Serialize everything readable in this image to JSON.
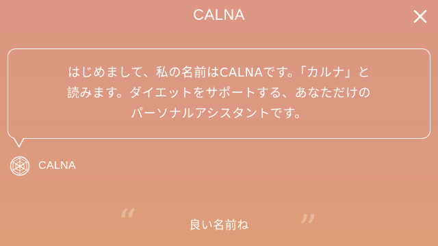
{
  "header": {
    "title": "CALNA",
    "close_icon": "close-icon"
  },
  "message": {
    "lines": [
      "はじめまして、私の名前はCALNAです。「カルナ」と",
      "読みます。ダイエットをサポートする、あなただけの",
      "パーソナルアシスタントです。"
    ]
  },
  "agent": {
    "name": "CALNA",
    "logo_icon": "calna-logo-icon"
  },
  "reply": {
    "text": "良い名前ね",
    "open_quote": "“",
    "close_quote": "”"
  },
  "colors": {
    "background_top": "#dc9681",
    "background_bottom": "#df9d76",
    "foreground": "#ffffff"
  }
}
